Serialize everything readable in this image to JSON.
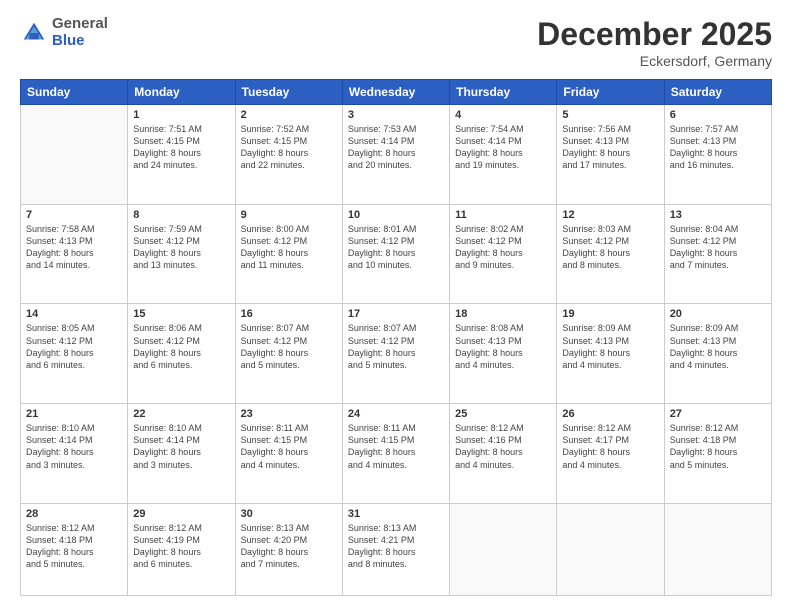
{
  "logo": {
    "general": "General",
    "blue": "Blue"
  },
  "header": {
    "month": "December 2025",
    "location": "Eckersdorf, Germany"
  },
  "weekdays": [
    "Sunday",
    "Monday",
    "Tuesday",
    "Wednesday",
    "Thursday",
    "Friday",
    "Saturday"
  ],
  "weeks": [
    [
      {
        "day": "",
        "info": ""
      },
      {
        "day": "1",
        "info": "Sunrise: 7:51 AM\nSunset: 4:15 PM\nDaylight: 8 hours\nand 24 minutes."
      },
      {
        "day": "2",
        "info": "Sunrise: 7:52 AM\nSunset: 4:15 PM\nDaylight: 8 hours\nand 22 minutes."
      },
      {
        "day": "3",
        "info": "Sunrise: 7:53 AM\nSunset: 4:14 PM\nDaylight: 8 hours\nand 20 minutes."
      },
      {
        "day": "4",
        "info": "Sunrise: 7:54 AM\nSunset: 4:14 PM\nDaylight: 8 hours\nand 19 minutes."
      },
      {
        "day": "5",
        "info": "Sunrise: 7:56 AM\nSunset: 4:13 PM\nDaylight: 8 hours\nand 17 minutes."
      },
      {
        "day": "6",
        "info": "Sunrise: 7:57 AM\nSunset: 4:13 PM\nDaylight: 8 hours\nand 16 minutes."
      }
    ],
    [
      {
        "day": "7",
        "info": "Sunrise: 7:58 AM\nSunset: 4:13 PM\nDaylight: 8 hours\nand 14 minutes."
      },
      {
        "day": "8",
        "info": "Sunrise: 7:59 AM\nSunset: 4:12 PM\nDaylight: 8 hours\nand 13 minutes."
      },
      {
        "day": "9",
        "info": "Sunrise: 8:00 AM\nSunset: 4:12 PM\nDaylight: 8 hours\nand 11 minutes."
      },
      {
        "day": "10",
        "info": "Sunrise: 8:01 AM\nSunset: 4:12 PM\nDaylight: 8 hours\nand 10 minutes."
      },
      {
        "day": "11",
        "info": "Sunrise: 8:02 AM\nSunset: 4:12 PM\nDaylight: 8 hours\nand 9 minutes."
      },
      {
        "day": "12",
        "info": "Sunrise: 8:03 AM\nSunset: 4:12 PM\nDaylight: 8 hours\nand 8 minutes."
      },
      {
        "day": "13",
        "info": "Sunrise: 8:04 AM\nSunset: 4:12 PM\nDaylight: 8 hours\nand 7 minutes."
      }
    ],
    [
      {
        "day": "14",
        "info": "Sunrise: 8:05 AM\nSunset: 4:12 PM\nDaylight: 8 hours\nand 6 minutes."
      },
      {
        "day": "15",
        "info": "Sunrise: 8:06 AM\nSunset: 4:12 PM\nDaylight: 8 hours\nand 6 minutes."
      },
      {
        "day": "16",
        "info": "Sunrise: 8:07 AM\nSunset: 4:12 PM\nDaylight: 8 hours\nand 5 minutes."
      },
      {
        "day": "17",
        "info": "Sunrise: 8:07 AM\nSunset: 4:12 PM\nDaylight: 8 hours\nand 5 minutes."
      },
      {
        "day": "18",
        "info": "Sunrise: 8:08 AM\nSunset: 4:13 PM\nDaylight: 8 hours\nand 4 minutes."
      },
      {
        "day": "19",
        "info": "Sunrise: 8:09 AM\nSunset: 4:13 PM\nDaylight: 8 hours\nand 4 minutes."
      },
      {
        "day": "20",
        "info": "Sunrise: 8:09 AM\nSunset: 4:13 PM\nDaylight: 8 hours\nand 4 minutes."
      }
    ],
    [
      {
        "day": "21",
        "info": "Sunrise: 8:10 AM\nSunset: 4:14 PM\nDaylight: 8 hours\nand 3 minutes."
      },
      {
        "day": "22",
        "info": "Sunrise: 8:10 AM\nSunset: 4:14 PM\nDaylight: 8 hours\nand 3 minutes."
      },
      {
        "day": "23",
        "info": "Sunrise: 8:11 AM\nSunset: 4:15 PM\nDaylight: 8 hours\nand 4 minutes."
      },
      {
        "day": "24",
        "info": "Sunrise: 8:11 AM\nSunset: 4:15 PM\nDaylight: 8 hours\nand 4 minutes."
      },
      {
        "day": "25",
        "info": "Sunrise: 8:12 AM\nSunset: 4:16 PM\nDaylight: 8 hours\nand 4 minutes."
      },
      {
        "day": "26",
        "info": "Sunrise: 8:12 AM\nSunset: 4:17 PM\nDaylight: 8 hours\nand 4 minutes."
      },
      {
        "day": "27",
        "info": "Sunrise: 8:12 AM\nSunset: 4:18 PM\nDaylight: 8 hours\nand 5 minutes."
      }
    ],
    [
      {
        "day": "28",
        "info": "Sunrise: 8:12 AM\nSunset: 4:18 PM\nDaylight: 8 hours\nand 5 minutes."
      },
      {
        "day": "29",
        "info": "Sunrise: 8:12 AM\nSunset: 4:19 PM\nDaylight: 8 hours\nand 6 minutes."
      },
      {
        "day": "30",
        "info": "Sunrise: 8:13 AM\nSunset: 4:20 PM\nDaylight: 8 hours\nand 7 minutes."
      },
      {
        "day": "31",
        "info": "Sunrise: 8:13 AM\nSunset: 4:21 PM\nDaylight: 8 hours\nand 8 minutes."
      },
      {
        "day": "",
        "info": ""
      },
      {
        "day": "",
        "info": ""
      },
      {
        "day": "",
        "info": ""
      }
    ]
  ]
}
